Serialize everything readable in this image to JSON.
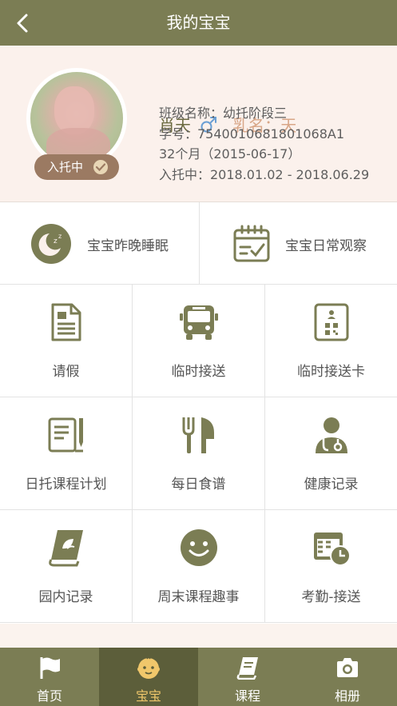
{
  "header": {
    "title": "我的宝宝"
  },
  "profile": {
    "status_badge": "入托中",
    "name": "肖天",
    "gender_symbol": "♂",
    "nickname_label": "乳名：",
    "nickname": "天",
    "class_line": "班级名称：幼托阶段三",
    "student_id_line": "学号：7540010681801068A1",
    "age_line": "32个月（2015-06-17）",
    "enroll_line": "入托中：2018.01.02 - 2018.06.29"
  },
  "quick": [
    {
      "label": "宝宝昨晚睡眠",
      "icon": "moon-sleep-icon"
    },
    {
      "label": "宝宝日常观察",
      "icon": "calendar-observe-icon"
    }
  ],
  "grid": [
    {
      "label": "请假",
      "icon": "document-icon"
    },
    {
      "label": "临时接送",
      "icon": "bus-icon"
    },
    {
      "label": "临时接送卡",
      "icon": "id-card-icon"
    },
    {
      "label": "日托课程计划",
      "icon": "notebook-pen-icon"
    },
    {
      "label": "每日食谱",
      "icon": "fork-knife-icon"
    },
    {
      "label": "健康记录",
      "icon": "doctor-icon"
    },
    {
      "label": "园内记录",
      "icon": "book-icon"
    },
    {
      "label": "周末课程趣事",
      "icon": "smile-icon"
    },
    {
      "label": "考勤-接送",
      "icon": "calendar-clock-icon"
    }
  ],
  "tabs": [
    {
      "label": "首页",
      "icon": "flag-icon"
    },
    {
      "label": "宝宝",
      "icon": "baby-icon",
      "active": true
    },
    {
      "label": "课程",
      "icon": "books-icon"
    },
    {
      "label": "相册",
      "icon": "camera-icon"
    }
  ],
  "colors": {
    "brand": "#7b7d54",
    "brand_dark": "#5c5e3a",
    "accent": "#f0c76b",
    "profile_bg": "#fbf1ec",
    "icon": "#7b7d54"
  }
}
